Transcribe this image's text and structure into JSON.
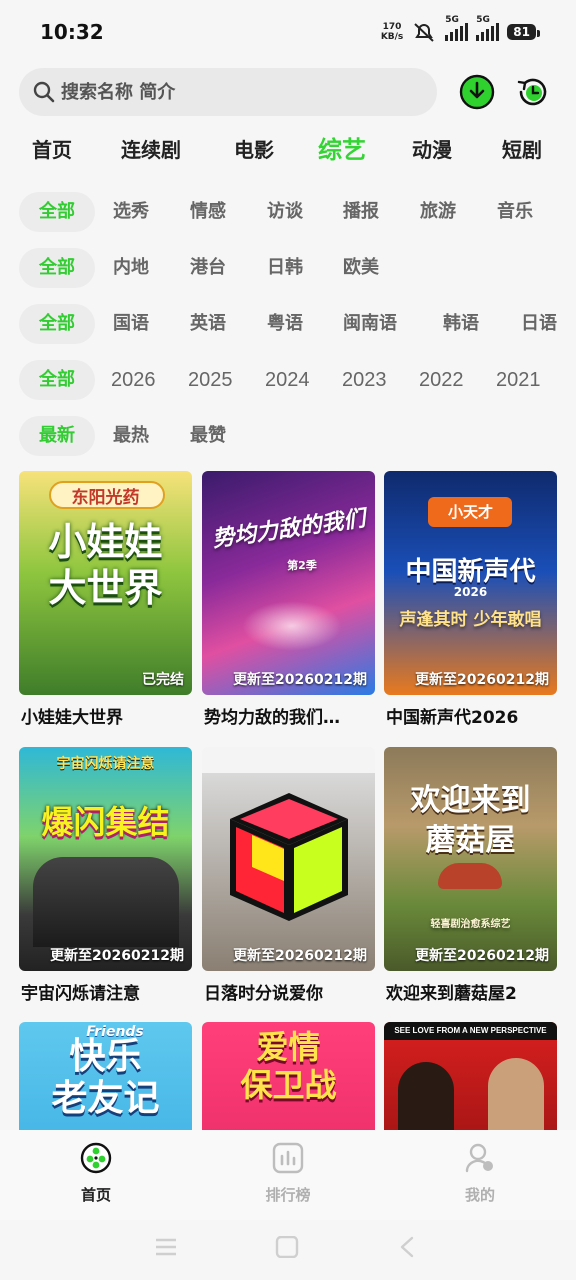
{
  "status": {
    "time": "10:32",
    "net_speed_value": "170",
    "net_speed_unit": "KB/s",
    "signal1_tag": "5G",
    "signal2_tag": "5G",
    "battery": "81"
  },
  "search": {
    "placeholder": "搜索名称 简介"
  },
  "icons": {
    "download": "download-icon",
    "history": "history-icon",
    "search": "search-icon"
  },
  "colors": {
    "accent": "#33d433",
    "chip_bg": "#ececec"
  },
  "category_tabs": [
    {
      "label": "首页"
    },
    {
      "label": "连续剧"
    },
    {
      "label": "电影"
    },
    {
      "label": "综艺",
      "active": true
    },
    {
      "label": "动漫"
    },
    {
      "label": "短剧"
    }
  ],
  "filters": {
    "type": [
      "全部",
      "选秀",
      "情感",
      "访谈",
      "播报",
      "旅游",
      "音乐"
    ],
    "region": [
      "全部",
      "内地",
      "港台",
      "日韩",
      "欧美"
    ],
    "language": [
      "全部",
      "国语",
      "英语",
      "粤语",
      "闽南语",
      "韩语",
      "日语"
    ],
    "year": [
      "全部",
      "2026",
      "2025",
      "2024",
      "2023",
      "2022",
      "2021"
    ],
    "sort": [
      "最新",
      "最热",
      "最赞"
    ]
  },
  "shows": [
    {
      "title": "小娃娃大世界",
      "badge": "已完结",
      "poster_text": "小娃娃\n大世界",
      "poster_brand": "东阳光药"
    },
    {
      "title": "势均力敌的我们…",
      "badge": "更新至20260212期",
      "poster_text": "势均力敌的我们",
      "poster_brand": "第2季"
    },
    {
      "title": "中国新声代2026",
      "badge": "更新至20260212期",
      "poster_text": "中国新声代",
      "poster_brand": "小天才",
      "poster_year": "2026",
      "poster_slogan": "声逢其时 少年敢唱"
    },
    {
      "title": "宇宙闪烁请注意",
      "badge": "更新至20260212期",
      "poster_text": "爆闪集结",
      "poster_brand": "宇宙闪烁请注意"
    },
    {
      "title": "日落时分说爱你",
      "badge": "更新至20260212期"
    },
    {
      "title": "欢迎来到蘑菇屋2",
      "badge": "更新至20260212期",
      "poster_text": "欢迎来到\n蘑菇屋",
      "poster_brand": "轻喜剧治愈系综艺"
    },
    {
      "title": "",
      "badge": "",
      "poster_text": "快乐\n老友记",
      "poster_brand": "Friends"
    },
    {
      "title": "",
      "badge": "",
      "poster_text": "爱情\n保卫战"
    },
    {
      "title": "",
      "badge": "",
      "poster_brand": "SEE LOVE FROM A NEW PERSPECTIVE"
    }
  ],
  "bottom_nav": [
    {
      "label": "首页",
      "icon": "film-reel-icon",
      "active": true
    },
    {
      "label": "排行榜",
      "icon": "chart-icon"
    },
    {
      "label": "我的",
      "icon": "profile-icon"
    }
  ]
}
